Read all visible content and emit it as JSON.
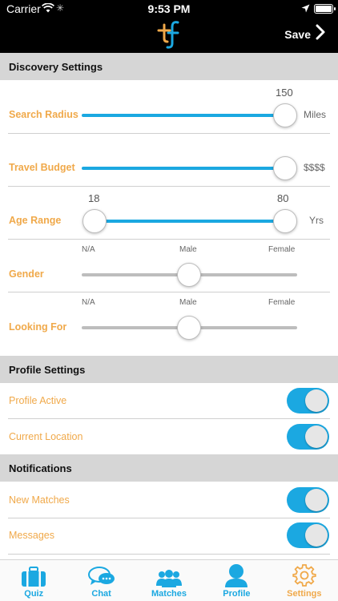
{
  "status_bar": {
    "carrier": "Carrier",
    "time": "9:53 PM"
  },
  "nav": {
    "save_label": "Save"
  },
  "colors": {
    "accent": "#1ba8e1",
    "label": "#f0a94a",
    "section_bg": "#d6d6d6",
    "inactive_track": "#bdbdbd"
  },
  "discovery": {
    "header": "Discovery Settings",
    "search_radius": {
      "label": "Search Radius",
      "value": "150",
      "unit": "Miles",
      "fraction": 1.0
    },
    "travel_budget": {
      "label": "Travel Budget",
      "unit": "$$$$",
      "fraction": 1.0
    },
    "age_range": {
      "label": "Age Range",
      "min": "18",
      "max": "80",
      "unit": "Yrs"
    },
    "gender": {
      "label": "Gender",
      "options": [
        "N/A",
        "Male",
        "Female"
      ],
      "selected": "Male"
    },
    "looking_for": {
      "label": "Looking For",
      "options": [
        "N/A",
        "Male",
        "Female"
      ],
      "selected": "Male"
    }
  },
  "profile": {
    "header": "Profile Settings",
    "profile_active": {
      "label": "Profile Active",
      "on": true
    },
    "current_location": {
      "label": "Current Location",
      "on": true
    }
  },
  "notifications": {
    "header": "Notifications",
    "new_matches": {
      "label": "New Matches",
      "on": true
    },
    "messages": {
      "label": "Messages",
      "on": true
    }
  },
  "tabs": [
    {
      "label": "Quiz",
      "icon": "suitcase-icon"
    },
    {
      "label": "Chat",
      "icon": "chat-bubbles-icon"
    },
    {
      "label": "Matches",
      "icon": "group-icon"
    },
    {
      "label": "Profile",
      "icon": "person-icon"
    },
    {
      "label": "Settings",
      "icon": "gear-icon",
      "active": true
    }
  ]
}
